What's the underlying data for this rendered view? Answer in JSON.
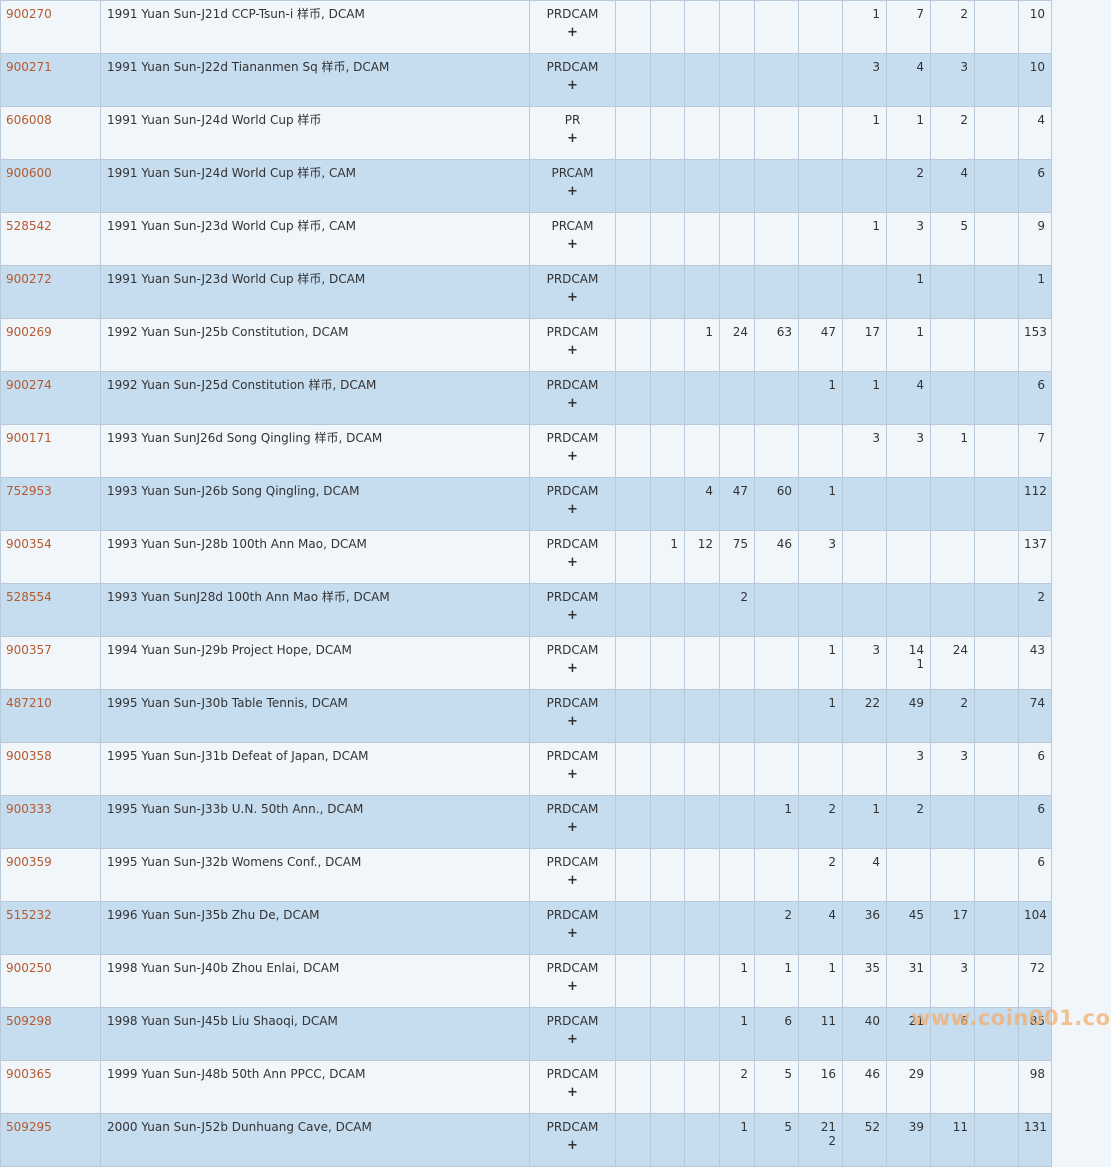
{
  "watermark": "www.coin001.com",
  "colors": {
    "link": "#b55a2c",
    "row_light": "#f1f6fb",
    "row_dark": "#c6dcef",
    "grid": "#b7c9da"
  },
  "rows": [
    {
      "code": "900270",
      "desc": "1991 Yuan Sun-J21d CCP-Tsun-i 样币, DCAM",
      "des": "PRDCAM",
      "plus": "+",
      "pops": [
        "",
        "",
        "",
        "",
        "",
        "",
        "1",
        "7",
        "2",
        ""
      ],
      "total": "10"
    },
    {
      "code": "900271",
      "desc": "1991 Yuan Sun-J22d Tiananmen Sq 样币, DCAM",
      "des": "PRDCAM",
      "plus": "+",
      "pops": [
        "",
        "",
        "",
        "",
        "",
        "",
        "3",
        "4",
        "3",
        ""
      ],
      "total": "10"
    },
    {
      "code": "606008",
      "desc": "1991 Yuan Sun-J24d World Cup 样币",
      "des": "PR",
      "plus": "+",
      "pops": [
        "",
        "",
        "",
        "",
        "",
        "",
        "1",
        "1",
        "2",
        ""
      ],
      "total": "4"
    },
    {
      "code": "900600",
      "desc": "1991 Yuan Sun-J24d World Cup 样币, CAM",
      "des": "PRCAM",
      "plus": "+",
      "pops": [
        "",
        "",
        "",
        "",
        "",
        "",
        "",
        "2",
        "4",
        ""
      ],
      "total": "6"
    },
    {
      "code": "528542",
      "desc": "1991 Yuan Sun-J23d World Cup 样币, CAM",
      "des": "PRCAM",
      "plus": "+",
      "pops": [
        "",
        "",
        "",
        "",
        "",
        "",
        "1",
        "3",
        "5",
        ""
      ],
      "total": "9"
    },
    {
      "code": "900272",
      "desc": "1991 Yuan Sun-J23d World Cup 样币, DCAM",
      "des": "PRDCAM",
      "plus": "+",
      "pops": [
        "",
        "",
        "",
        "",
        "",
        "",
        "",
        "1",
        "",
        ""
      ],
      "total": "1"
    },
    {
      "code": "900269",
      "desc": "1992 Yuan Sun-J25b Constitution, DCAM",
      "des": "PRDCAM",
      "plus": "+",
      "pops": [
        "",
        "",
        "1",
        "24",
        "63",
        "47",
        "17",
        "1",
        "",
        ""
      ],
      "total": "153"
    },
    {
      "code": "900274",
      "desc": "1992 Yuan Sun-J25d Constitution 样币, DCAM",
      "des": "PRDCAM",
      "plus": "+",
      "pops": [
        "",
        "",
        "",
        "",
        "",
        "1",
        "1",
        "4",
        "",
        ""
      ],
      "total": "6"
    },
    {
      "code": "900171",
      "desc": "1993 Yuan SunJ26d Song Qingling 样币, DCAM",
      "des": "PRDCAM",
      "plus": "+",
      "pops": [
        "",
        "",
        "",
        "",
        "",
        "",
        "3",
        "3",
        "1",
        ""
      ],
      "total": "7"
    },
    {
      "code": "752953",
      "desc": "1993 Yuan Sun-J26b Song Qingling, DCAM",
      "des": "PRDCAM",
      "plus": "+",
      "pops": [
        "",
        "",
        "4",
        "47",
        "60",
        "1",
        "",
        "",
        "",
        ""
      ],
      "total": "112"
    },
    {
      "code": "900354",
      "desc": "1993 Yuan Sun-J28b 100th Ann Mao, DCAM",
      "des": "PRDCAM",
      "plus": "+",
      "pops": [
        "",
        "1",
        "12",
        "75",
        "46",
        "3",
        "",
        "",
        "",
        ""
      ],
      "total": "137"
    },
    {
      "code": "528554",
      "desc": "1993 Yuan SunJ28d 100th Ann Mao 样币, DCAM",
      "des": "PRDCAM",
      "plus": "+",
      "pops": [
        "",
        "",
        "",
        "2",
        "",
        "",
        "",
        "",
        "",
        ""
      ],
      "total": "2"
    },
    {
      "code": "900357",
      "desc": "1994 Yuan Sun-J29b Project Hope, DCAM",
      "des": "PRDCAM",
      "plus": "+",
      "pops": [
        "",
        "",
        "",
        "",
        "",
        "1",
        "3",
        "14\n1",
        "24",
        ""
      ],
      "total": "43"
    },
    {
      "code": "487210",
      "desc": "1995 Yuan Sun-J30b Table Tennis, DCAM",
      "des": "PRDCAM",
      "plus": "+",
      "pops": [
        "",
        "",
        "",
        "",
        "",
        "1",
        "22",
        "49",
        "2",
        ""
      ],
      "total": "74"
    },
    {
      "code": "900358",
      "desc": "1995 Yuan Sun-J31b Defeat of Japan, DCAM",
      "des": "PRDCAM",
      "plus": "+",
      "pops": [
        "",
        "",
        "",
        "",
        "",
        "",
        "",
        "3",
        "3",
        ""
      ],
      "total": "6"
    },
    {
      "code": "900333",
      "desc": "1995 Yuan Sun-J33b U.N. 50th Ann., DCAM",
      "des": "PRDCAM",
      "plus": "+",
      "pops": [
        "",
        "",
        "",
        "",
        "1",
        "2",
        "1",
        "2",
        "",
        ""
      ],
      "total": "6"
    },
    {
      "code": "900359",
      "desc": "1995 Yuan Sun-J32b Womens Conf., DCAM",
      "des": "PRDCAM",
      "plus": "+",
      "pops": [
        "",
        "",
        "",
        "",
        "",
        "2",
        "4",
        "",
        "",
        ""
      ],
      "total": "6"
    },
    {
      "code": "515232",
      "desc": "1996 Yuan Sun-J35b Zhu De, DCAM",
      "des": "PRDCAM",
      "plus": "+",
      "pops": [
        "",
        "",
        "",
        "",
        "2",
        "4",
        "36",
        "45",
        "17",
        ""
      ],
      "total": "104"
    },
    {
      "code": "900250",
      "desc": "1998 Yuan Sun-J40b Zhou Enlai, DCAM",
      "des": "PRDCAM",
      "plus": "+",
      "pops": [
        "",
        "",
        "",
        "1",
        "1",
        "1",
        "35",
        "31",
        "3",
        ""
      ],
      "total": "72"
    },
    {
      "code": "509298",
      "desc": "1998 Yuan Sun-J45b Liu Shaoqi, DCAM",
      "des": "PRDCAM",
      "plus": "+",
      "pops": [
        "",
        "",
        "",
        "1",
        "6",
        "11",
        "40",
        "21",
        "6",
        ""
      ],
      "total": "85"
    },
    {
      "code": "900365",
      "desc": "1999 Yuan Sun-J48b 50th Ann PPCC, DCAM",
      "des": "PRDCAM",
      "plus": "+",
      "pops": [
        "",
        "",
        "",
        "2",
        "5",
        "16",
        "46",
        "29",
        "",
        ""
      ],
      "total": "98"
    },
    {
      "code": "509295",
      "desc": "2000 Yuan Sun-J52b Dunhuang Cave, DCAM",
      "des": "PRDCAM",
      "plus": "+",
      "pops": [
        "",
        "",
        "",
        "1",
        "5",
        "21\n2",
        "52",
        "39",
        "11",
        ""
      ],
      "total": "131"
    }
  ]
}
